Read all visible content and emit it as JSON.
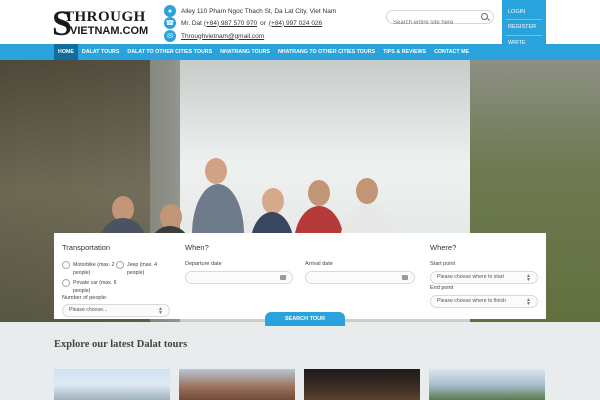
{
  "logo": {
    "line1": "THROUGH",
    "line2": "VIETNAM.COM"
  },
  "contact": {
    "address": "Alley 110 Pham Ngoc Thach St, Da Lat City, Viet Nam",
    "phone_prefix": "Mr. Dat",
    "phone1": "(+84) 987 570 970",
    "or": "or",
    "phone2": "(+84) 997 024 026",
    "email": "Throughvietnam@gmail.com"
  },
  "search": {
    "placeholder": "Search entire site here"
  },
  "user_menu": {
    "login": "LOGIN",
    "register": "REGISTER",
    "reviews": "WRITE REVIEWS/TIPS"
  },
  "nav": {
    "items": [
      {
        "label": "HOME"
      },
      {
        "label": "DALAT TOURS"
      },
      {
        "label": "DALAT TO OTHER CITIES TOURS"
      },
      {
        "label": "NHATRANG TOURS"
      },
      {
        "label": "NHATRANG TO OTHER CITIES TOURS"
      },
      {
        "label": "TIPS & REVIEWS"
      },
      {
        "label": "CONTACT ME"
      }
    ]
  },
  "booking": {
    "transportation_title": "Transportation",
    "options": {
      "motorbike": "Motorbike (max. 2 people)",
      "jeep": "Jeep (max. 4 people)",
      "private_car": "Private car (max. 6 people)"
    },
    "num_people_label": "Number of people:",
    "num_people_value": "Please choose...",
    "when_title": "When?",
    "departure_label": "Departure date",
    "arrival_label": "Arrival date",
    "where_title": "Where?",
    "start_label": "Start point",
    "start_value": "Please choose where to start",
    "end_label": "End point",
    "end_value": "Please choose where to finish",
    "search_button": "SEARCH TOUR"
  },
  "explore": {
    "title": "Explore our latest Dalat tours"
  },
  "colors": {
    "accent": "#2aa2dc",
    "nav_active": "#0f6e9c"
  },
  "icons": [
    "map-marker-icon",
    "phone-icon",
    "email-icon",
    "search-icon",
    "calendar-icon",
    "dropdown-arrow-icon"
  ]
}
